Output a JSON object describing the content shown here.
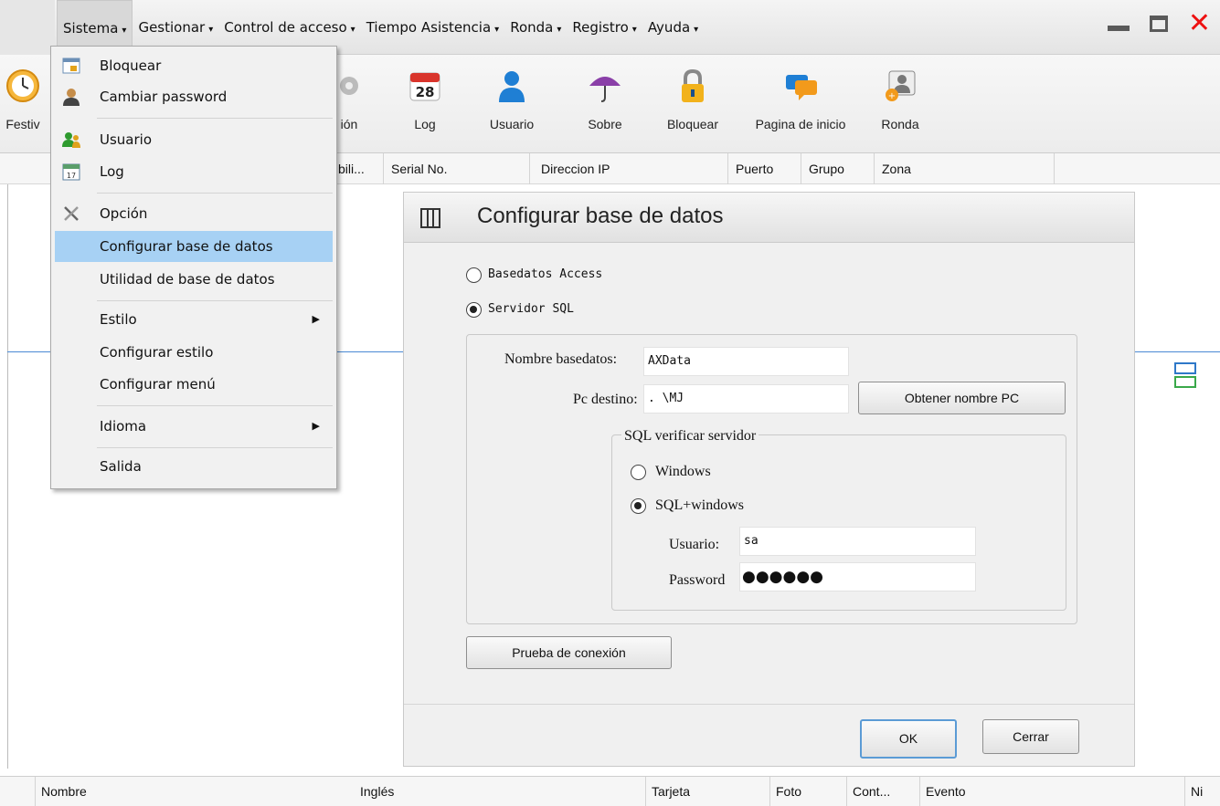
{
  "menubar": {
    "items": [
      {
        "label": "Sistema"
      },
      {
        "label": "Gestionar"
      },
      {
        "label": "Control de acceso"
      },
      {
        "label": "Tiempo Asistencia"
      },
      {
        "label": "Ronda"
      },
      {
        "label": "Registro"
      },
      {
        "label": "Ayuda"
      }
    ]
  },
  "toolbar": {
    "items": [
      {
        "label": "Festiv",
        "icon": "clock-icon"
      },
      {
        "label": "ión",
        "icon": "gear-icon"
      },
      {
        "label": "Log",
        "icon": "calendar-icon",
        "calendar_day": "28"
      },
      {
        "label": "Usuario",
        "icon": "user-icon"
      },
      {
        "label": "Sobre",
        "icon": "umbrella-icon"
      },
      {
        "label": "Bloquear",
        "icon": "lock-icon"
      },
      {
        "label": "Pagina de inicio",
        "icon": "chat-bubbles-icon"
      },
      {
        "label": "Ronda",
        "icon": "patrol-icon"
      }
    ]
  },
  "columns": [
    "bili...",
    "Serial No.",
    "Direccion IP",
    "Puerto",
    "Grupo",
    "Zona"
  ],
  "bottom_columns": [
    "Nombre",
    "Inglés",
    "Tarjeta",
    "Foto",
    "Cont...",
    "Evento",
    "Ni"
  ],
  "dropdown": {
    "items": [
      {
        "label": "Bloquear",
        "icon": "lock-screen-icon"
      },
      {
        "label": "Cambiar password",
        "icon": "user-key-icon"
      },
      {
        "label": "Usuario",
        "icon": "users-icon"
      },
      {
        "label": "Log",
        "icon": "calendar-icon",
        "calendar_day": "17"
      },
      {
        "label": "Opción",
        "icon": "tools-icon"
      },
      {
        "label": "Configurar base de datos"
      },
      {
        "label": "Utilidad de base de datos"
      },
      {
        "label": "Estilo"
      },
      {
        "label": "Configurar estilo"
      },
      {
        "label": "Configurar menú"
      },
      {
        "label": "Idioma"
      },
      {
        "label": "Salida"
      }
    ]
  },
  "dialog": {
    "title": "Configurar base de datos",
    "radio_access": "Basedatos Access",
    "radio_sql": "Servidor SQL",
    "dbname_label": "Nombre basedatos:",
    "dbname_value": "AXData",
    "pc_label": "Pc destino:",
    "pc_value": ". \\MJ",
    "get_pc_button": "Obtener nombre PC",
    "verify_group_label": "SQL verificar servidor",
    "radio_windows": "Windows",
    "radio_sqlwin": "SQL+windows",
    "user_label": "Usuario:",
    "user_value": "sa",
    "password_label": "Password",
    "password_mask": "●●●●●●",
    "test_button": "Prueba de conexión",
    "ok_button": "OK",
    "close_button": "Cerrar"
  },
  "colors": {
    "highlight": "#a7d1f4",
    "close_red": "#e11111",
    "accent_blue": "#4a8ad4"
  }
}
